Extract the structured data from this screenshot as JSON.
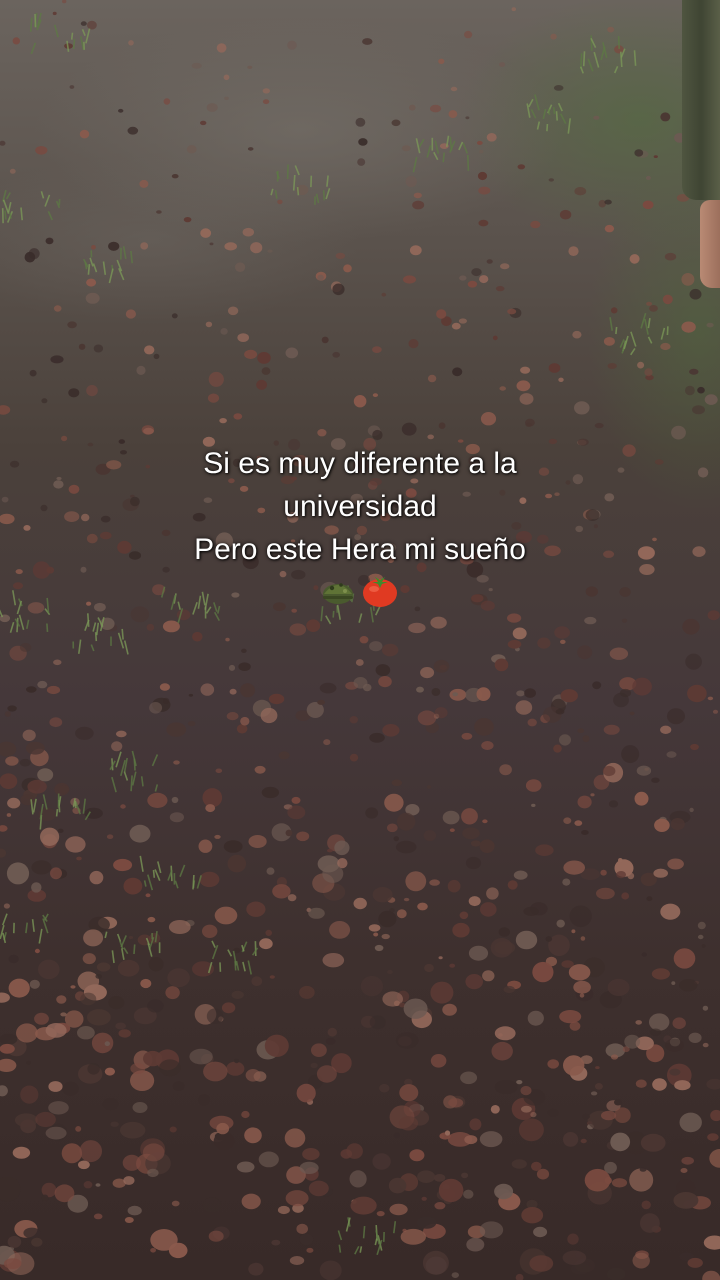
{
  "caption": {
    "line1": "Si es muy diferente a la",
    "line2": "universidad",
    "line3": "Pero este Hera mi sueño",
    "emojis": [
      "army-helmet-emoji",
      "tomato-emoji"
    ]
  },
  "scene": {
    "background": "wet gravel ground with grass patches",
    "colors": {
      "ground": "#45383a",
      "mud": "#6b645e",
      "grass": "#5d7a44",
      "pebble": "#7a4a40",
      "text": "#ffffff"
    }
  }
}
